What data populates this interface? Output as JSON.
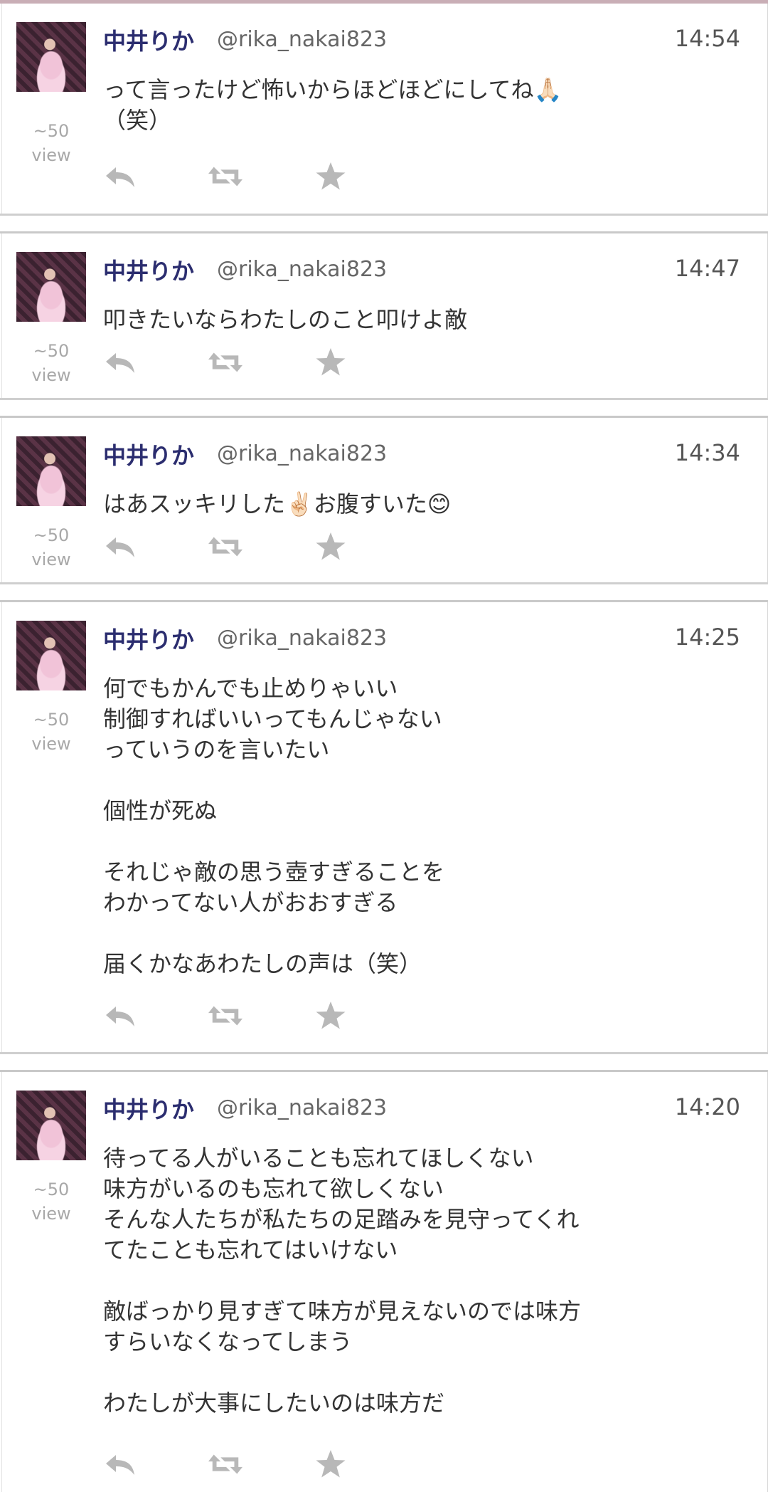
{
  "colors": {
    "accent_bar": "#c9aeb6",
    "name": "#2b2d6f",
    "icon": "#b8b8b8"
  },
  "tweets": [
    {
      "name": "中井りか",
      "handle": "@rika_nakai823",
      "time": "14:54",
      "views": "~50",
      "views_unit": "view",
      "text": "って言ったけど怖いからほどほどにしてね🙏🏻\n（笑）"
    },
    {
      "name": "中井りか",
      "handle": "@rika_nakai823",
      "time": "14:47",
      "views": "~50",
      "views_unit": "view",
      "text": "叩きたいならわたしのこと叩けよ敵"
    },
    {
      "name": "中井りか",
      "handle": "@rika_nakai823",
      "time": "14:34",
      "views": "~50",
      "views_unit": "view",
      "text": "はあスッキリした✌🏻お腹すいた😊"
    },
    {
      "name": "中井りか",
      "handle": "@rika_nakai823",
      "time": "14:25",
      "views": "~50",
      "views_unit": "view",
      "text": "何でもかんでも止めりゃいい\n制御すればいいってもんじゃない\nっていうのを言いたい\n\n個性が死ぬ\n\nそれじゃ敵の思う壺すぎることを\nわかってない人がおおすぎる\n\n届くかなあわたしの声は（笑）"
    },
    {
      "name": "中井りか",
      "handle": "@rika_nakai823",
      "time": "14:20",
      "views": "~50",
      "views_unit": "view",
      "text": "待ってる人がいることも忘れてほしくない\n味方がいるのも忘れて欲しくない\nそんな人たちが私たちの足踏みを見守ってくれ\nてたことも忘れてはいけない\n\n敵ばっかり見すぎて味方が見えないのでは味方\nすらいなくなってしまう\n\nわたしが大事にしたいのは味方だ"
    }
  ],
  "icons": {
    "reply": "reply-icon",
    "retweet": "retweet-icon",
    "favorite": "star-icon"
  }
}
